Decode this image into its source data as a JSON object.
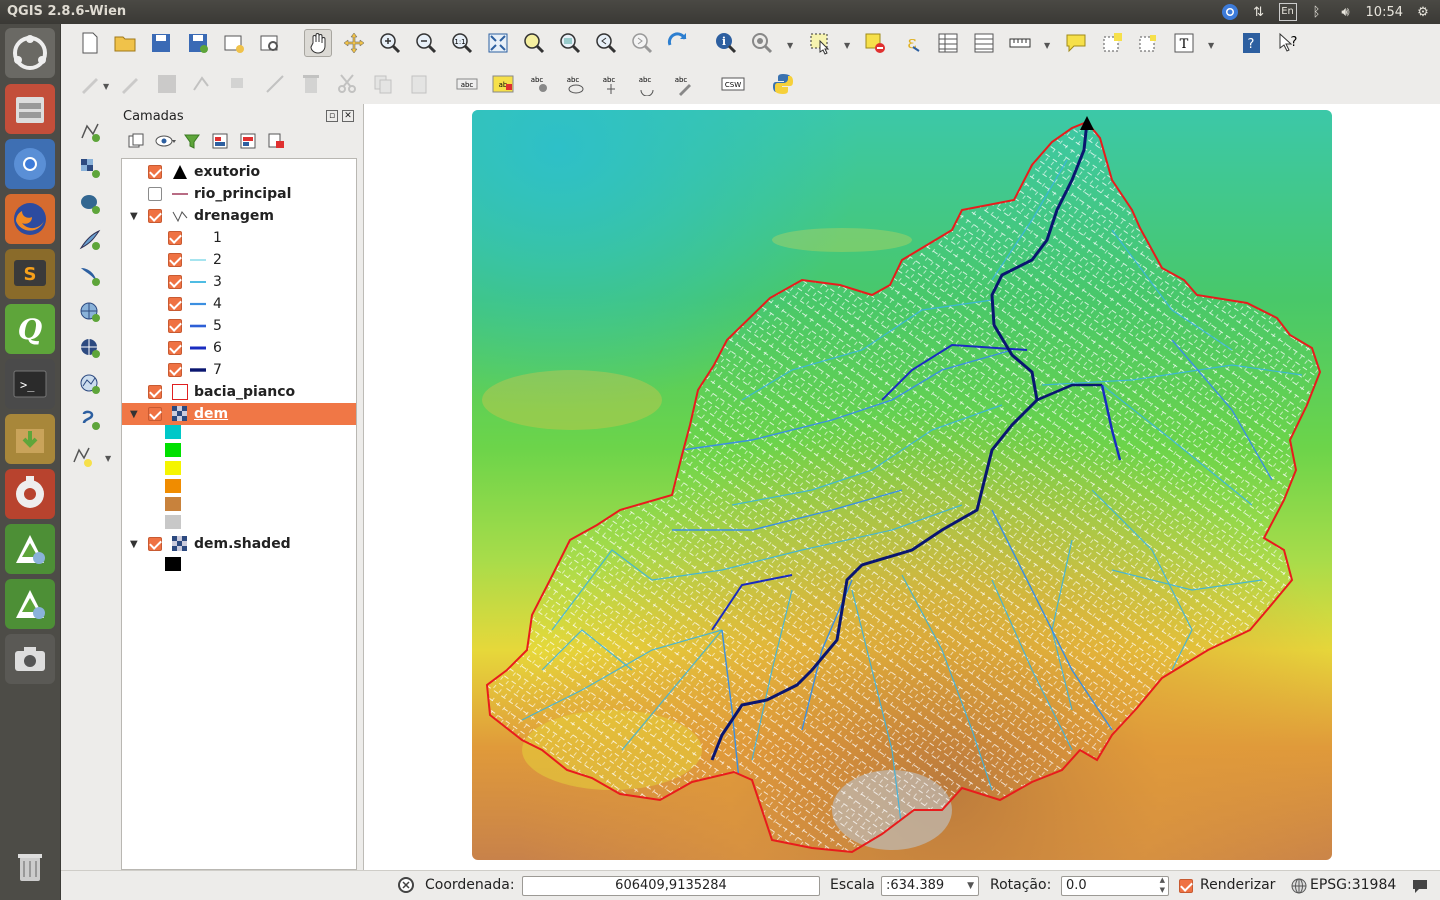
{
  "window": {
    "title": "QGIS 2.8.6-Wien"
  },
  "tray": {
    "lang": "En",
    "clock": "10:54"
  },
  "launcher": {
    "items": [
      "dash-icon",
      "files-icon",
      "chromium-icon",
      "firefox-icon",
      "sublime-icon",
      "qgis-icon",
      "terminal-icon",
      "installer-icon",
      "settings-icon",
      "qgis-browser-icon",
      "qgis-browser-2-icon",
      "screenshot-icon",
      "trash-icon"
    ]
  },
  "layers_panel": {
    "title": "Camadas",
    "layers": [
      {
        "name": "exutorio",
        "checked": true
      },
      {
        "name": "rio_principal",
        "checked": false
      },
      {
        "name": "drenagem",
        "checked": true
      },
      {
        "name": "bacia_pianco",
        "checked": true
      },
      {
        "name": "dem",
        "checked": true
      },
      {
        "name": "dem.shaded",
        "checked": true
      }
    ],
    "drenagem_classes": [
      {
        "label": "1",
        "color": "#ffffff"
      },
      {
        "label": "2",
        "color": "#7fd8e8"
      },
      {
        "label": "3",
        "color": "#3bb4e0"
      },
      {
        "label": "4",
        "color": "#3c8fe0"
      },
      {
        "label": "5",
        "color": "#2d5fd6"
      },
      {
        "label": "6",
        "color": "#1a2cc0"
      },
      {
        "label": "7",
        "color": "#0a1670"
      }
    ],
    "dem_colors": [
      "#00c8c8",
      "#00e000",
      "#f5f500",
      "#f08c00",
      "#c8823c",
      "#c8c8c8"
    ],
    "shaded_color": "#000000"
  },
  "statusbar": {
    "coord_label": "Coordenada:",
    "coord_value": "606409,9135284",
    "scale_label": "Escala",
    "scale_value": ":634.389",
    "rotation_label": "Rotação:",
    "rotation_value": "0.0",
    "render_label": "Renderizar",
    "render_checked": true,
    "crs": "EPSG:31984"
  }
}
